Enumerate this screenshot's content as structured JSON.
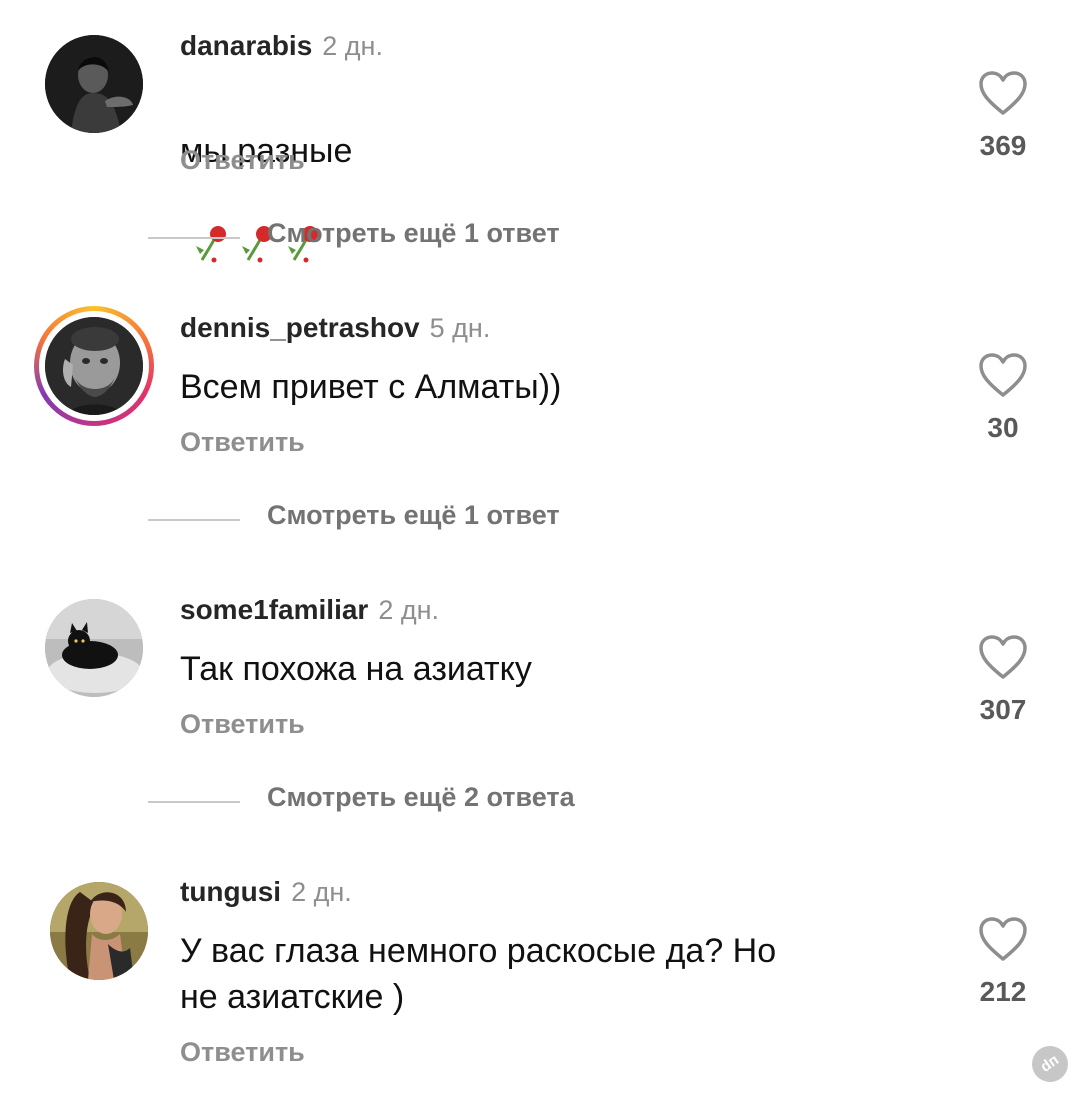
{
  "comments": [
    {
      "username": "danarabis",
      "time": "2 дн.",
      "text": "мы разные",
      "emoji": "🥀🥀🥀",
      "reply": "Ответить",
      "likes": "369",
      "more_replies": "Смотреть ещё 1 ответ",
      "avatar": "dark-portrait-avatar"
    },
    {
      "username": "dennis_petrashov",
      "time": "5 дн.",
      "text": "Всем привет с Алматы))",
      "reply": "Ответить",
      "likes": "30",
      "more_replies": "Смотреть ещё 1 ответ",
      "avatar": "man-portrait-avatar-story-ring"
    },
    {
      "username": "some1familiar",
      "time": "2 дн.",
      "text": "Так похожа на азиатку",
      "reply": "Ответить",
      "likes": "307",
      "more_replies": "Смотреть ещё 2 ответа",
      "avatar": "black-cat-avatar"
    },
    {
      "username": "tungusi",
      "time": "2 дн.",
      "text": "У вас глаза немного раскосые да?  Но\nне азиатские )",
      "reply": "Ответить",
      "likes": "212",
      "avatar": "painted-woman-avatar"
    }
  ],
  "watermark": "dп",
  "colors": {
    "background": "#ffffff",
    "secondary_text": "#8e8e8e",
    "story_ring": [
      "#f9c22e",
      "#e1306c",
      "#833ab4"
    ]
  }
}
